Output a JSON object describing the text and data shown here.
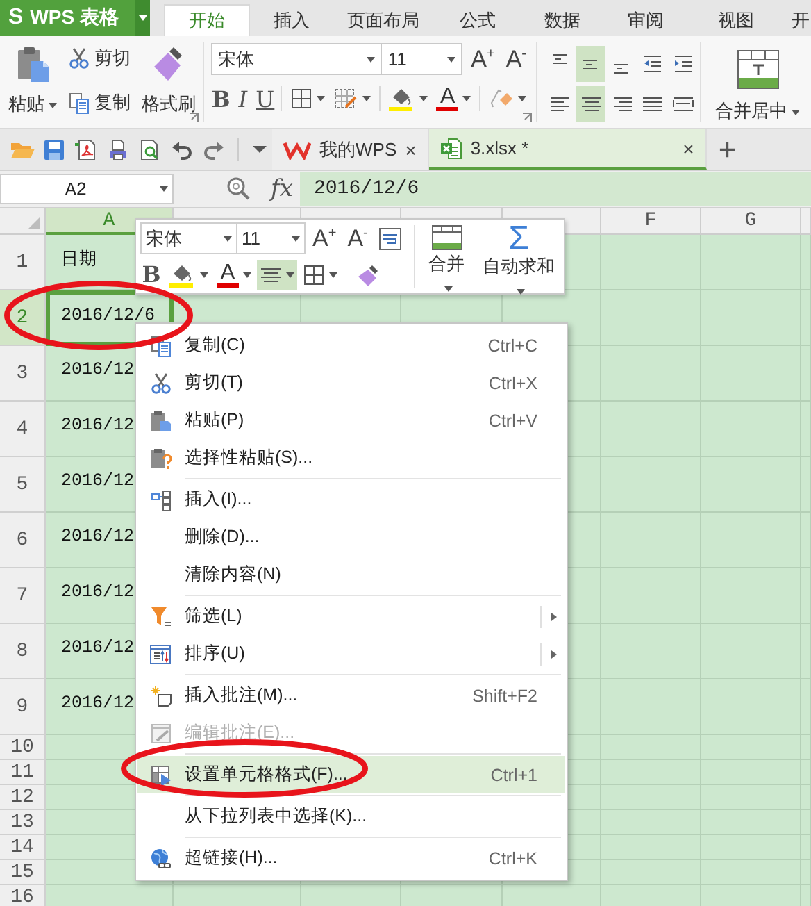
{
  "app_button": {
    "logo": "S",
    "label": "WPS 表格"
  },
  "ribbon_tabs": [
    {
      "label": "开始",
      "selected": true
    },
    {
      "label": "插入",
      "selected": false
    },
    {
      "label": "页面布局",
      "selected": false
    },
    {
      "label": "公式",
      "selected": false
    },
    {
      "label": "数据",
      "selected": false
    },
    {
      "label": "审阅",
      "selected": false
    },
    {
      "label": "视图",
      "selected": false
    },
    {
      "label": "开",
      "selected": false
    }
  ],
  "ribbon": {
    "paste": "粘贴",
    "cut": "剪切",
    "copy": "复制",
    "format_painter": "格式刷",
    "font": "宋体",
    "font_size": "11",
    "grow_font": "A$^{+}$",
    "shrink_font": "A$^{-}$",
    "bold": "B",
    "italic": "I",
    "underline": "U",
    "font_color": "A",
    "vertical_align": [
      {
        "selected": false
      },
      {
        "selected": true
      },
      {
        "selected": false
      }
    ],
    "horizontal_align": [
      {
        "selected": false
      },
      {
        "selected": true
      },
      {
        "selected": false
      },
      {
        "selected": false
      },
      {
        "selected": false
      }
    ],
    "merge_center": "合并居中"
  },
  "doc_tabs": [
    {
      "label": "我的WPS",
      "selected": false,
      "close": "×"
    },
    {
      "label": "3.xlsx *",
      "selected": true,
      "close": "×"
    }
  ],
  "new_tab": "+",
  "formula_bar": {
    "cell_name": "A2",
    "fx": "fx",
    "value": "2016/12/6"
  },
  "sheet": {
    "columns": [
      {
        "header": "A",
        "selected": true
      },
      {
        "selected": false
      },
      {
        "selected": false
      },
      {
        "selected": false
      },
      {
        "selected": false
      },
      {
        "header": "F",
        "selected": false
      },
      {
        "header": "G",
        "selected": false
      },
      {
        "selected": false
      }
    ],
    "rows": [
      {
        "number": "1",
        "selected": false,
        "cell": "日期"
      },
      {
        "number": "2",
        "selected": true,
        "cell": "2016/12/6"
      },
      {
        "number": "3",
        "selected": false,
        "cell": "2016/12"
      },
      {
        "number": "4",
        "selected": false,
        "cell": "2016/12"
      },
      {
        "number": "5",
        "selected": false,
        "cell": "2016/12"
      },
      {
        "number": "6",
        "selected": false,
        "cell": "2016/12"
      },
      {
        "number": "7",
        "selected": false,
        "cell": "2016/12"
      },
      {
        "number": "8",
        "selected": false,
        "cell": "2016/12"
      },
      {
        "number": "9",
        "selected": false,
        "cell": "2016/12"
      },
      {
        "number": "10",
        "selected": false
      },
      {
        "number": "11",
        "selected": false
      },
      {
        "number": "12",
        "selected": false
      },
      {
        "number": "13",
        "selected": false
      },
      {
        "number": "14",
        "selected": false
      },
      {
        "number": "15",
        "selected": false
      },
      {
        "number": "16",
        "selected": false
      }
    ]
  },
  "mini_toolbar": {
    "font": "宋体",
    "font_size": "11",
    "grow_font": "A$^{+}$",
    "shrink_font": "A$^{-}$",
    "bold": "B",
    "font_color": "A",
    "align_selected": true,
    "merge": "合并",
    "autosum_icon": "Σ",
    "autosum": "自动求和"
  },
  "context_menu": {
    "groups": [
      [
        {
          "label": "复制(C)",
          "shortcut": "Ctrl+C",
          "disabled": false,
          "selected": false,
          "submenu": false
        },
        {
          "label": "剪切(T)",
          "shortcut": "Ctrl+X",
          "disabled": false,
          "selected": false,
          "submenu": false
        },
        {
          "label": "粘贴(P)",
          "shortcut": "Ctrl+V",
          "disabled": false,
          "selected": false,
          "submenu": false
        },
        {
          "label": "选择性粘贴(S)...",
          "disabled": false,
          "selected": false,
          "submenu": false
        }
      ],
      [
        {
          "label": "插入(I)...",
          "disabled": false,
          "selected": false,
          "submenu": false
        },
        {
          "label": "删除(D)...",
          "disabled": false,
          "selected": false,
          "submenu": false
        },
        {
          "label": "清除内容(N)",
          "disabled": false,
          "selected": false,
          "submenu": false
        }
      ],
      [
        {
          "label": "筛选(L)",
          "disabled": false,
          "selected": false,
          "submenu": true
        },
        {
          "label": "排序(U)",
          "disabled": false,
          "selected": false,
          "submenu": true
        }
      ],
      [
        {
          "label": "插入批注(M)...",
          "shortcut": "Shift+F2",
          "disabled": false,
          "selected": false,
          "submenu": false
        },
        {
          "label": "编辑批注(E)...",
          "disabled": true,
          "selected": false,
          "submenu": false
        }
      ],
      [
        {
          "label": "设置单元格格式(F)...",
          "shortcut": "Ctrl+1",
          "disabled": false,
          "selected": true,
          "submenu": false
        }
      ],
      [
        {
          "label": "从下拉列表中选择(K)...",
          "disabled": false,
          "selected": false,
          "submenu": false
        }
      ],
      [
        {
          "label": "超链接(H)...",
          "shortcut": "Ctrl+K",
          "disabled": false,
          "selected": false,
          "submenu": false
        }
      ]
    ]
  }
}
